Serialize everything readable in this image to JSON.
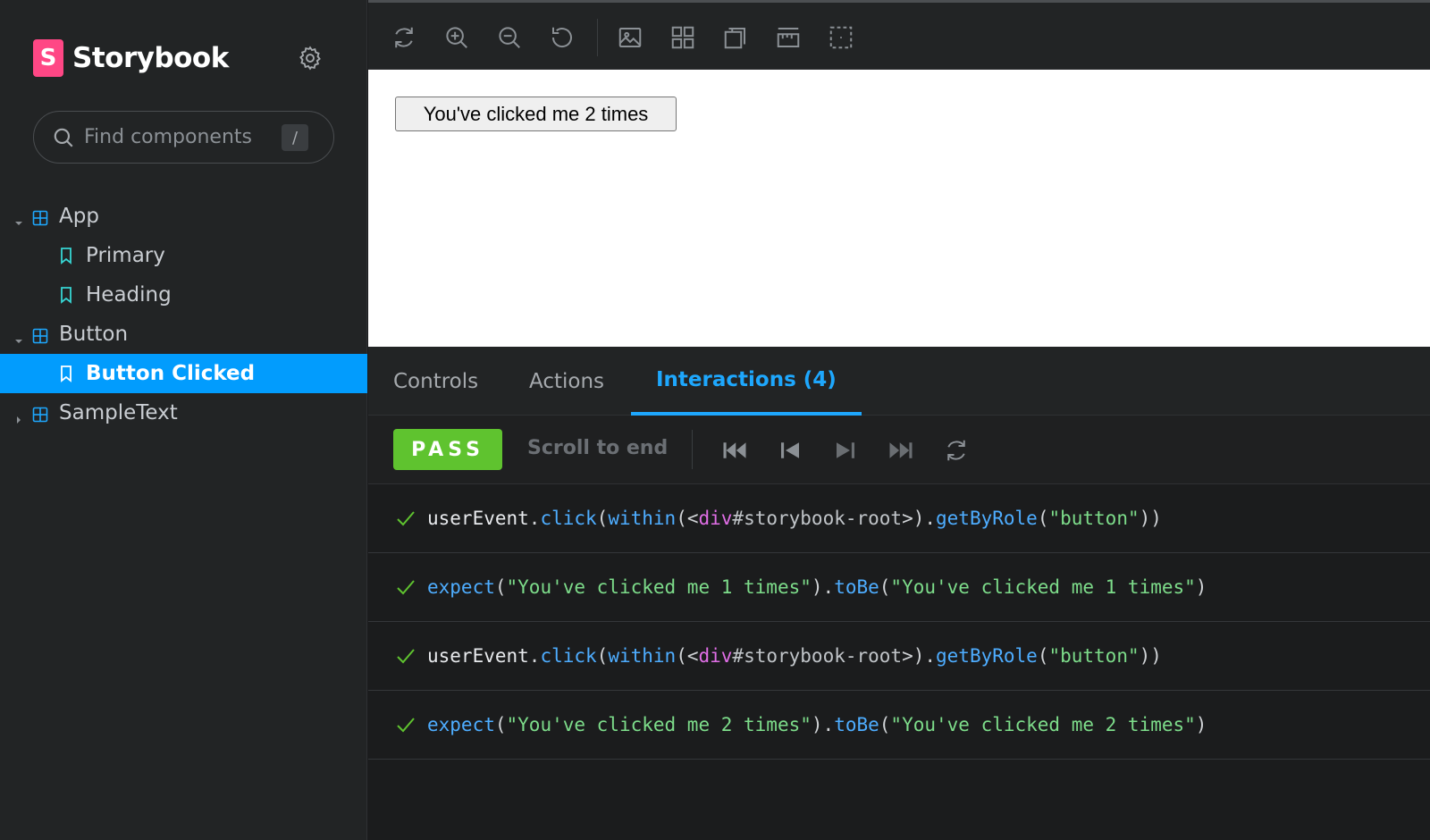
{
  "sidebar": {
    "brand": {
      "logo_letter": "S",
      "name": "Storybook"
    },
    "settings_icon": "gear-icon",
    "search": {
      "placeholder": "Find components",
      "shortcut": "/"
    },
    "tree": [
      {
        "type": "component",
        "label": "App",
        "expanded": true
      },
      {
        "type": "story",
        "label": "Primary"
      },
      {
        "type": "story",
        "label": "Heading"
      },
      {
        "type": "component",
        "label": "Button",
        "expanded": true
      },
      {
        "type": "story",
        "label": "Button Clicked",
        "selected": true
      },
      {
        "type": "component",
        "label": "SampleText",
        "expanded": false
      }
    ]
  },
  "toolbar": {
    "tools": [
      "reload-icon",
      "zoom-in-icon",
      "zoom-out-icon",
      "zoom-reset-icon",
      "background-icon",
      "grid-icon",
      "viewport-icon",
      "measure-icon",
      "outline-icon"
    ]
  },
  "canvas": {
    "button_label": "You've clicked me 2 times"
  },
  "panel": {
    "tabs": [
      {
        "label": "Controls",
        "active": false
      },
      {
        "label": "Actions",
        "active": false
      },
      {
        "label": "Interactions (4)",
        "active": true
      }
    ],
    "status": "PASS",
    "scroll_label": "Scroll to end",
    "steps": [
      {
        "kind": "click",
        "parts": [
          "userEvent",
          ".",
          "click",
          "(",
          "within",
          "(<",
          "div",
          "#storybook-root",
          ">).",
          "getByRole",
          "(",
          "\"button\"",
          "))"
        ]
      },
      {
        "kind": "expect",
        "parts": [
          "expect",
          "(",
          "\"You've clicked me 1 times\"",
          ").",
          "toBe",
          "(",
          "\"You've clicked me 1 times\"",
          ")"
        ]
      },
      {
        "kind": "click",
        "parts": [
          "userEvent",
          ".",
          "click",
          "(",
          "within",
          "(<",
          "div",
          "#storybook-root",
          ">).",
          "getByRole",
          "(",
          "\"button\"",
          "))"
        ]
      },
      {
        "kind": "expect",
        "parts": [
          "expect",
          "(",
          "\"You've clicked me 2 times\"",
          ").",
          "toBe",
          "(",
          "\"You've clicked me 2 times\"",
          ")"
        ]
      }
    ]
  },
  "colors": {
    "accent": "#1ea7fd",
    "selected_bg": "#029cfd",
    "pass": "#5fc32f",
    "brand": "#ff4785"
  }
}
